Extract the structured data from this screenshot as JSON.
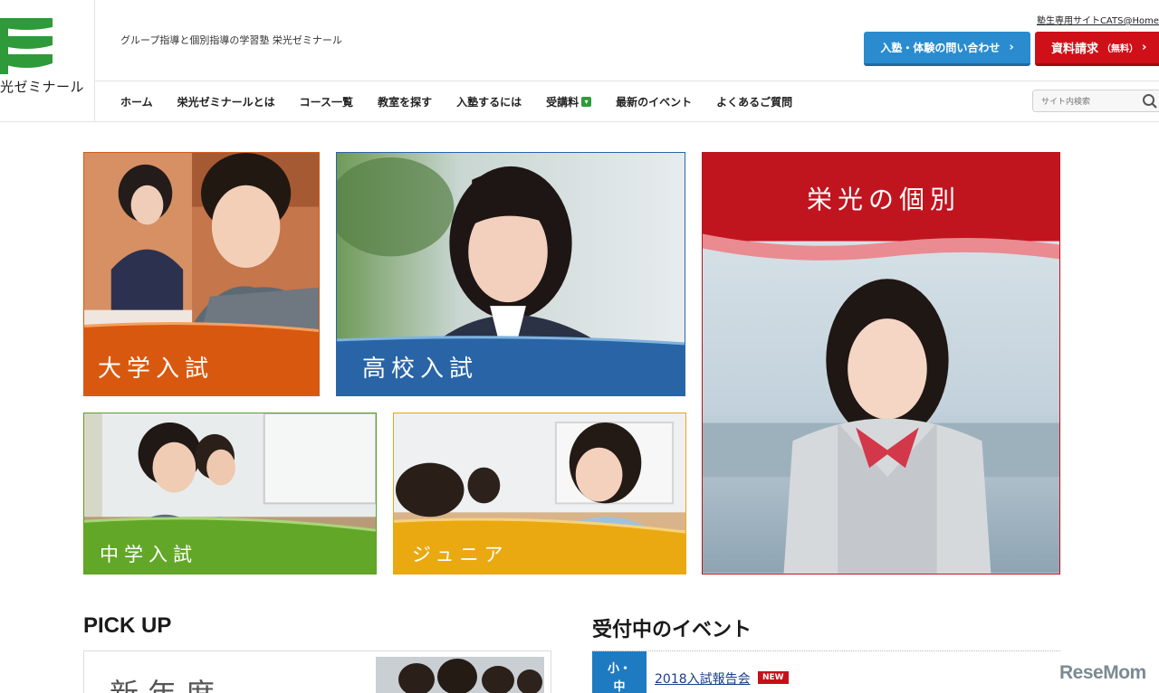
{
  "header": {
    "logo_text": "光ゼミナール",
    "tagline": "グループ指導と個別指導の学習塾 栄光ゼミナール",
    "top_link": "塾生専用サイトCATS@Home",
    "contact_button": "入塾・体験の問い合わせ",
    "request_button": "資料請求",
    "request_button_sub": "（無料）",
    "search_placeholder": "サイト内検索"
  },
  "nav": {
    "items": [
      {
        "label": "ホーム"
      },
      {
        "label": "栄光ゼミナールとは"
      },
      {
        "label": "コース一覧"
      },
      {
        "label": "教室を探す"
      },
      {
        "label": "入塾するには"
      },
      {
        "label": "受講料"
      },
      {
        "label": "最新のイベント"
      },
      {
        "label": "よくあるご質問"
      }
    ]
  },
  "tiles": {
    "daigaku": "大学入試",
    "koko": "高校入試",
    "chugaku": "中学入試",
    "junior": "ジュニア",
    "kobetsu": "栄光の個別"
  },
  "pickup": {
    "heading": "PICK UP",
    "banner_text": "新年度"
  },
  "events": {
    "heading": "受付中のイベント",
    "items": [
      {
        "tag_line1": "小・",
        "tag_line2": "中",
        "title": "2018入試報告会",
        "badge": "NEW"
      }
    ]
  },
  "watermark": "ReseMom",
  "colors": {
    "brand_green": "#2e9a3a",
    "contact_blue": "#2a8ccf",
    "request_red": "#d01018",
    "daigaku_orange": "#d9580f",
    "koko_blue": "#2864a6",
    "chugaku_green": "#63a728",
    "junior_yellow": "#eaa910",
    "kobetsu_red": "#c0151f"
  }
}
